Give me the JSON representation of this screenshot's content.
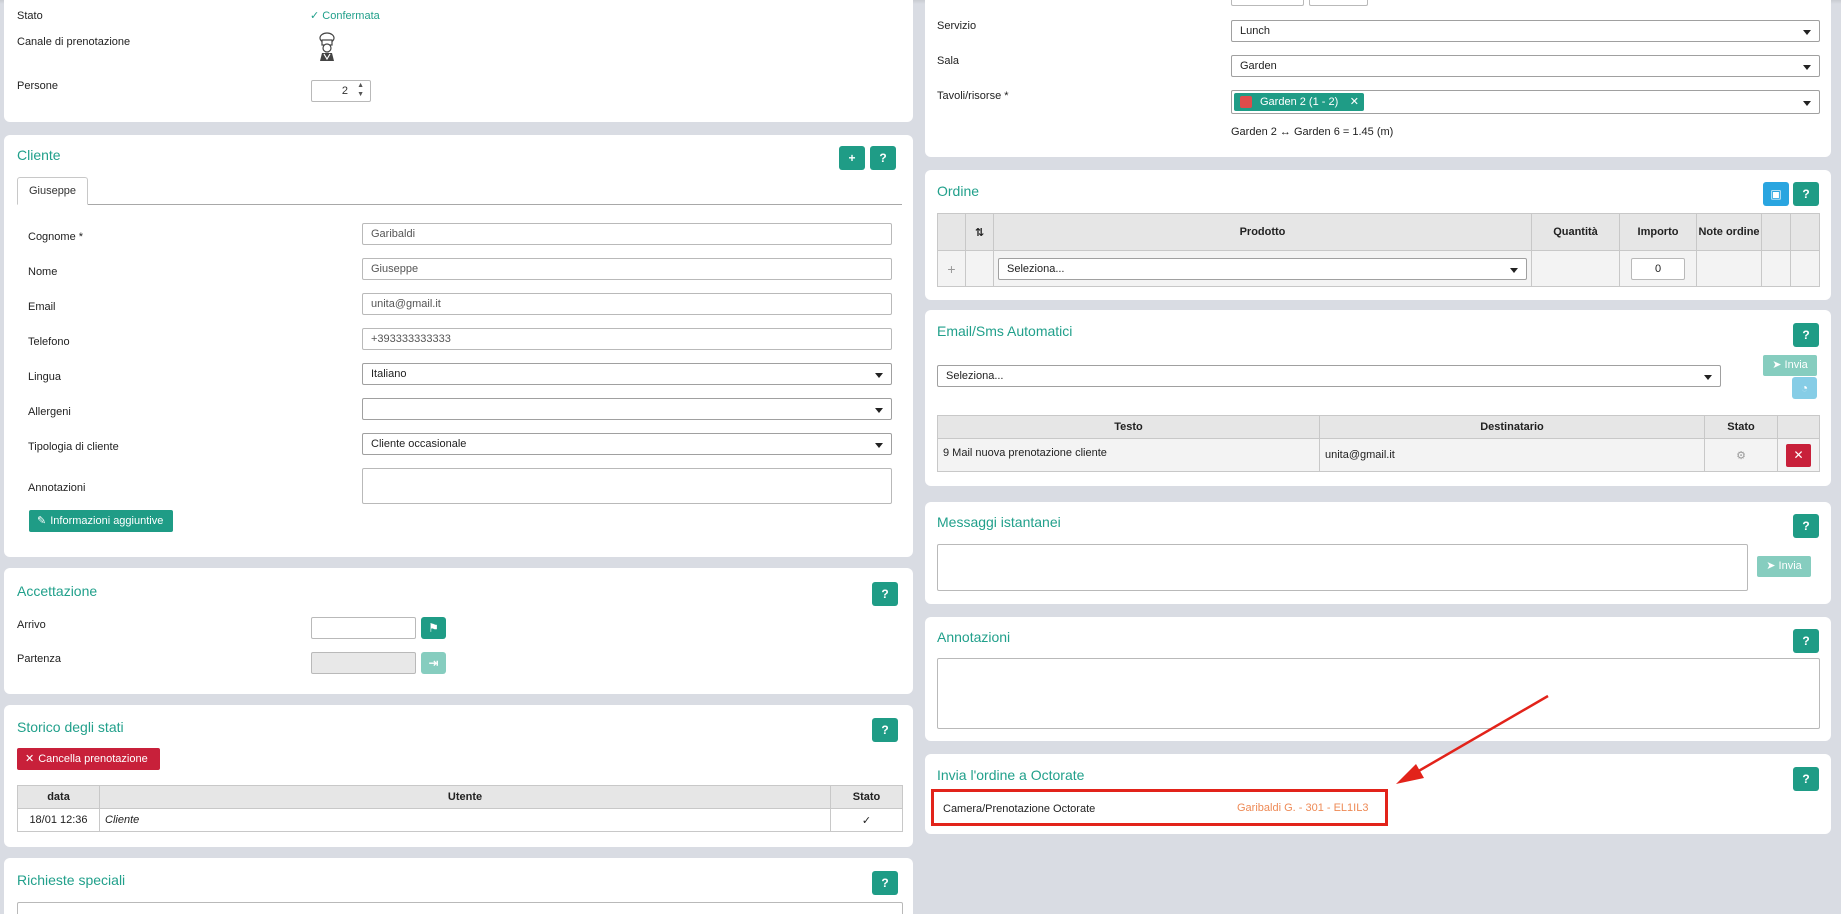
{
  "booking": {
    "stato_label": "Stato",
    "stato_value": "Confermata",
    "canale_label": "Canale di prenotazione",
    "persone_label": "Persone",
    "persone_value": "2"
  },
  "servizio": {
    "servizio_label": "Servizio",
    "servizio_value": "Lunch",
    "sala_label": "Sala",
    "sala_value": "Garden",
    "tavoli_label": "Tavoli/risorse *",
    "tavoli_tag": "Garden 2 (1 - 2)",
    "distance_text": "Garden 2 ↔ Garden 6 = 1.45 (m)"
  },
  "cliente": {
    "title": "Cliente",
    "tab_label": "Giuseppe",
    "fields": [
      {
        "label": "Cognome *",
        "value": "Garibaldi"
      },
      {
        "label": "Nome",
        "value": "Giuseppe"
      },
      {
        "label": "Email",
        "value": "unita@gmail.it"
      },
      {
        "label": "Telefono",
        "value": "+393333333333"
      }
    ],
    "lingua_label": "Lingua",
    "lingua_value": "Italiano",
    "allergeni_label": "Allergeni",
    "allergeni_value": "",
    "tipologia_label": "Tipologia di cliente",
    "tipologia_value": "Cliente occasionale",
    "annotazioni_label": "Annotazioni",
    "info_button": "Informazioni aggiuntive"
  },
  "accettazione": {
    "title": "Accettazione",
    "arrivo_label": "Arrivo",
    "partenza_label": "Partenza"
  },
  "storico": {
    "title": "Storico degli stati",
    "cancel_button": "Cancella prenotazione",
    "headers": [
      "data",
      "Utente",
      "Stato"
    ],
    "rows": [
      {
        "data": "18/01 12:36",
        "utente": "Cliente",
        "stato": "✓"
      }
    ]
  },
  "richieste": {
    "title": "Richieste speciali"
  },
  "ordine": {
    "title": "Ordine",
    "headers": [
      "Prodotto",
      "Quantità",
      "Importo",
      "Note ordine"
    ],
    "product_placeholder": "Seleziona...",
    "importo_value": "0"
  },
  "email_sms": {
    "title": "Email/Sms Automatici",
    "select_placeholder": "Seleziona...",
    "send_label": "Invia",
    "headers": [
      "Testo",
      "Destinatario",
      "Stato"
    ],
    "rows": [
      {
        "testo": "9 Mail nuova prenotazione cliente",
        "destinatario": "unita@gmail.it"
      }
    ]
  },
  "messaggi": {
    "title": "Messaggi istantanei",
    "send_label": "Invia"
  },
  "annotazioni": {
    "title": "Annotazioni"
  },
  "octorate": {
    "title": "Invia l'ordine a Octorate",
    "label": "Camera/Prenotazione Octorate",
    "value": "Garibaldi G. - 301 - EL1IL3"
  },
  "help_label": "?",
  "colors": {
    "accent": "#1f9c86",
    "danger": "#c8203a",
    "highlight": "#e2231a",
    "octorate_value": "#ee8a56"
  }
}
